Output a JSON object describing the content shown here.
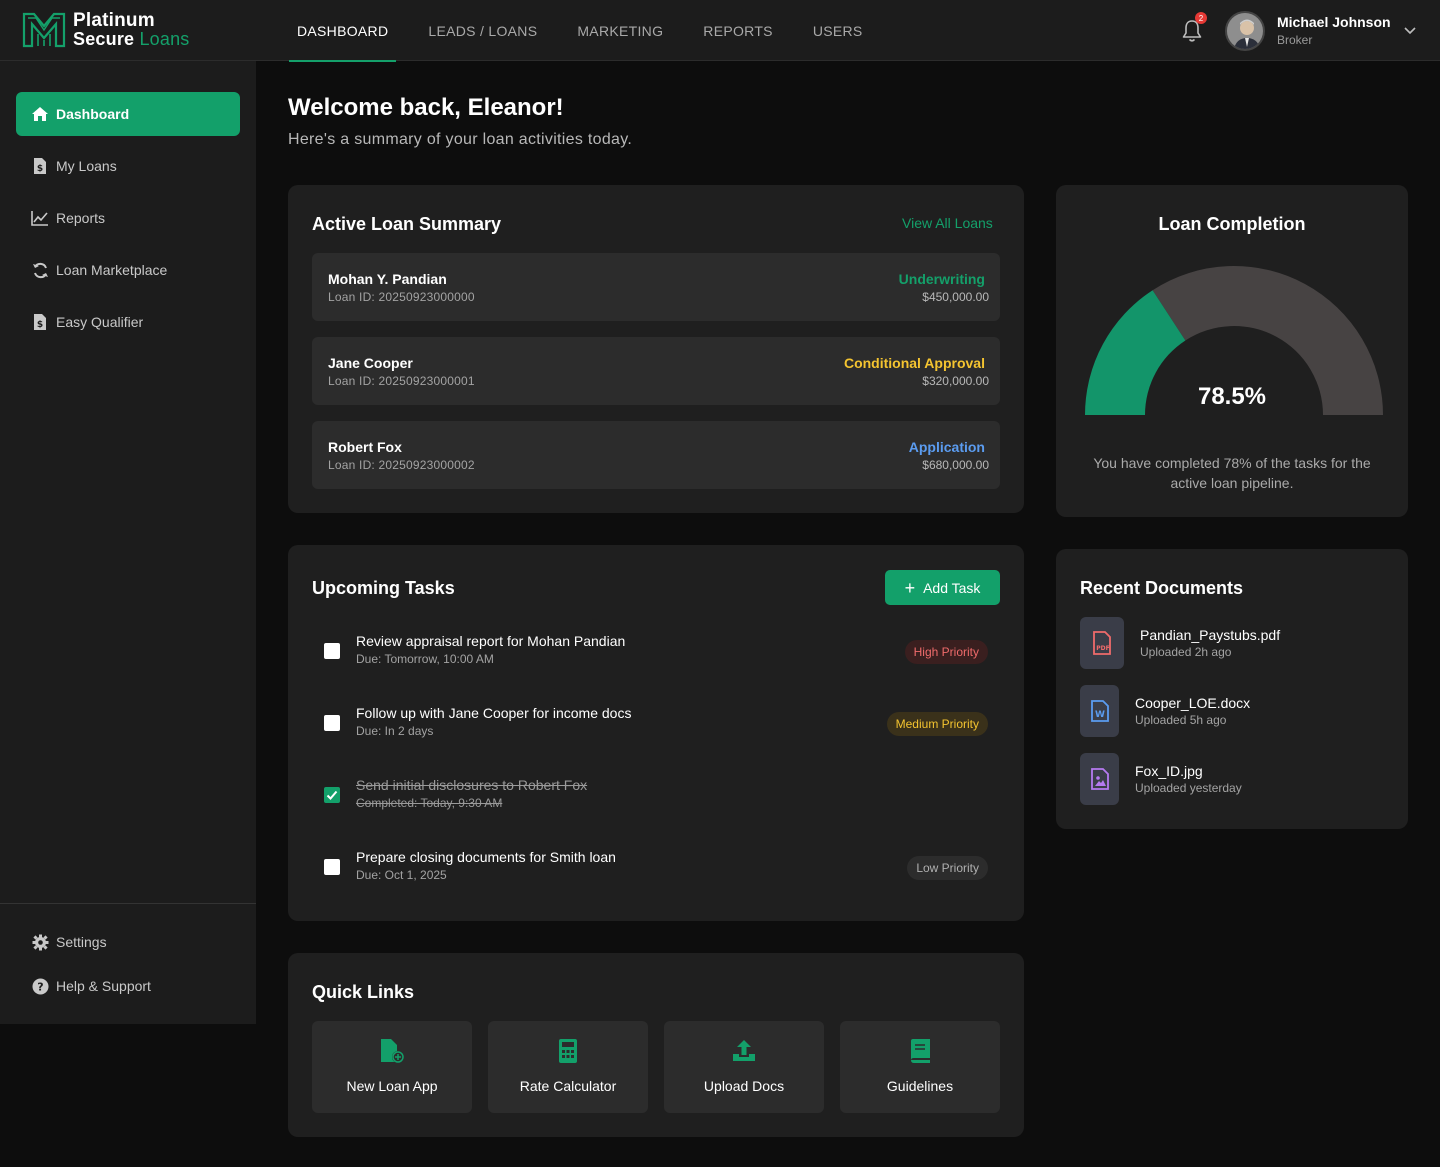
{
  "brand": {
    "line1": "Platinum",
    "line2a": "Secure",
    "line2b": "Loans"
  },
  "nav": {
    "items": [
      "DASHBOARD",
      "LEADS / LOANS",
      "MARKETING",
      "REPORTS",
      "USERS"
    ]
  },
  "notifications": {
    "count": "2"
  },
  "user": {
    "name": "Michael Johnson",
    "role": "Broker"
  },
  "sidebar": {
    "items": [
      {
        "label": "Dashboard",
        "icon": "home-icon"
      },
      {
        "label": "My Loans",
        "icon": "document-dollar-icon"
      },
      {
        "label": "Reports",
        "icon": "chart-line-icon"
      },
      {
        "label": "Loan Marketplace",
        "icon": "refresh-icon"
      },
      {
        "label": "Easy Qualifier",
        "icon": "document-dollar-icon"
      }
    ],
    "bottom": [
      {
        "label": "Settings",
        "icon": "gear-icon"
      },
      {
        "label": "Help & Support",
        "icon": "question-icon"
      }
    ]
  },
  "page": {
    "welcome": "Welcome back, Eleanor!",
    "subtitle": "Here's a summary of your loan activities today."
  },
  "loans": {
    "title": "Active Loan Summary",
    "view_all": "View All Loans",
    "rows": [
      {
        "name": "Mohan Y. Pandian",
        "id": "Loan ID: 20250923000000",
        "status": "Underwriting",
        "amount": "$450,000.00",
        "color": "#14a06a"
      },
      {
        "name": "Jane Cooper",
        "id": "Loan ID: 20250923000001",
        "status": "Conditional Approval",
        "amount": "$320,000.00",
        "color": "#f4c430"
      },
      {
        "name": "Robert Fox",
        "id": "Loan ID: 20250923000002",
        "status": "Application",
        "amount": "$680,000.00",
        "color": "#5b9cf0"
      }
    ]
  },
  "completion": {
    "title": "Loan Completion",
    "value": "78.5%",
    "percent": 0.785,
    "description": "You have completed 78% of the tasks for the active loan pipeline.",
    "colors": {
      "fill": "#13956a",
      "track": "#474343"
    }
  },
  "tasks": {
    "title": "Upcoming Tasks",
    "add_label": "Add Task",
    "items": [
      {
        "title": "Review appraisal report for Mohan Pandian",
        "due": "Due: Tomorrow, 10:00 AM",
        "priority": "High Priority",
        "done": false
      },
      {
        "title": "Follow up with Jane Cooper for income docs",
        "due": "Due: In 2 days",
        "priority": "Medium Priority",
        "done": false
      },
      {
        "title": "Send initial disclosures to Robert Fox",
        "due": "Completed: Today, 9:30 AM",
        "priority": "",
        "done": true
      },
      {
        "title": "Prepare closing documents for Smith loan",
        "due": "Due: Oct 1, 2025",
        "priority": "Low Priority",
        "done": false
      }
    ]
  },
  "documents": {
    "title": "Recent Documents",
    "items": [
      {
        "name": "Pandian_Paystubs.pdf",
        "time": "Uploaded 2h ago",
        "icon": "pdf-file-icon"
      },
      {
        "name": "Cooper_LOE.docx",
        "time": "Uploaded 5h ago",
        "icon": "word-file-icon"
      },
      {
        "name": "Fox_ID.jpg",
        "time": "Uploaded yesterday",
        "icon": "image-file-icon"
      }
    ]
  },
  "quick_links": {
    "title": "Quick Links",
    "items": [
      {
        "label": "New Loan App",
        "icon": "new-file-icon"
      },
      {
        "label": "Rate Calculator",
        "icon": "calculator-icon"
      },
      {
        "label": "Upload Docs",
        "icon": "upload-icon"
      },
      {
        "label": "Guidelines",
        "icon": "book-icon"
      }
    ]
  }
}
